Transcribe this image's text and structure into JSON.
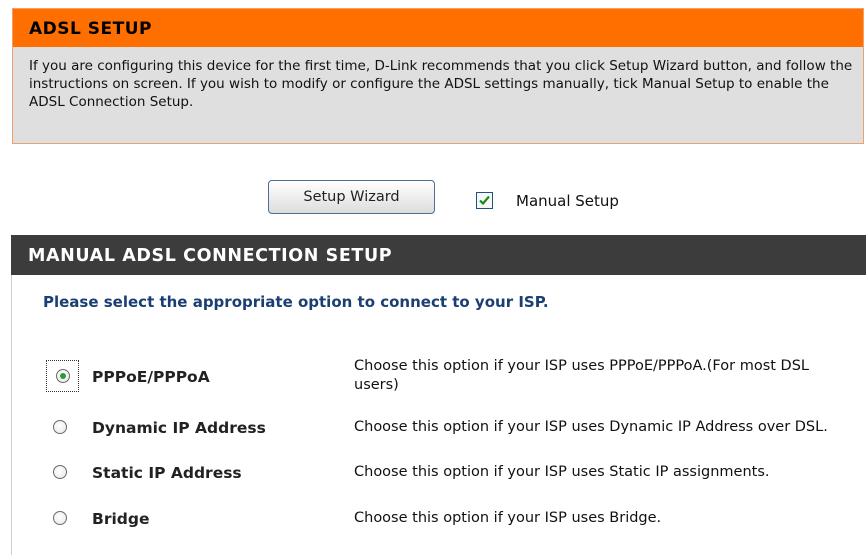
{
  "adsl_setup": {
    "title": "ADSL SETUP",
    "description": "If you are configuring this device for the first time, D-Link recommends that you click Setup Wizard button, and follow the instructions on screen. If you wish to modify or configure the ADSL settings manually, tick Manual Setup to enable the ADSL Connection Setup."
  },
  "wizard": {
    "button_label": "Setup Wizard",
    "manual_setup_label": "Manual Setup",
    "manual_setup_checked": true
  },
  "manual_section": {
    "title": "MANUAL ADSL CONNECTION SETUP",
    "prompt": "Please select the appropriate option to connect to your ISP.",
    "options": [
      {
        "label": "PPPoE/PPPoA",
        "description": "Choose this option if your ISP uses PPPoE/PPPoA.(For most DSL users)",
        "selected": true
      },
      {
        "label": "Dynamic IP Address",
        "description": "Choose this option if your ISP uses Dynamic IP Address over DSL.",
        "selected": false
      },
      {
        "label": "Static IP Address",
        "description": "Choose this option if your ISP uses Static IP assignments.",
        "selected": false
      },
      {
        "label": "Bridge",
        "description": "Choose this option if your ISP uses Bridge.",
        "selected": false
      }
    ]
  },
  "colors": {
    "setup_header_bg": "#ff6f00",
    "manual_header_bg": "#3c3c3c",
    "prompt_text": "#1b3f73",
    "radio_selected": "#2a9a3a"
  }
}
